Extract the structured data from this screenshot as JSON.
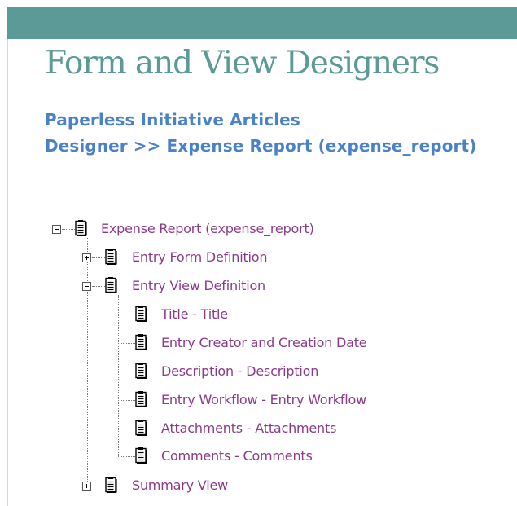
{
  "colors": {
    "banner": "#5b9a96",
    "title": "#5b9a96",
    "breadcrumb": "#4a82c9",
    "tree_text": "#8b3a8b"
  },
  "page": {
    "title": "Form and View Designers",
    "breadcrumb_line1": "Paperless Initiative Articles",
    "breadcrumb_line2": "Designer >> Expense Report (expense_report)"
  },
  "tree": {
    "root": {
      "label": "Expense Report (expense_report)",
      "state": "expanded",
      "icon": "document-icon"
    },
    "entry_form": {
      "label": "Entry Form Definition",
      "state": "collapsed",
      "icon": "document-icon"
    },
    "entry_view": {
      "label": "Entry View Definition",
      "state": "expanded",
      "icon": "document-icon",
      "children": [
        {
          "label": "Title - Title",
          "icon": "document-icon"
        },
        {
          "label": "Entry Creator and Creation Date",
          "icon": "document-icon"
        },
        {
          "label": "Description - Description",
          "icon": "document-icon"
        },
        {
          "label": "Entry Workflow - Entry Workflow",
          "icon": "document-icon"
        },
        {
          "label": "Attachments - Attachments",
          "icon": "document-icon"
        },
        {
          "label": "Comments - Comments",
          "icon": "document-icon"
        }
      ]
    },
    "summary_view": {
      "label": "Summary View",
      "state": "collapsed",
      "icon": "document-icon"
    }
  }
}
